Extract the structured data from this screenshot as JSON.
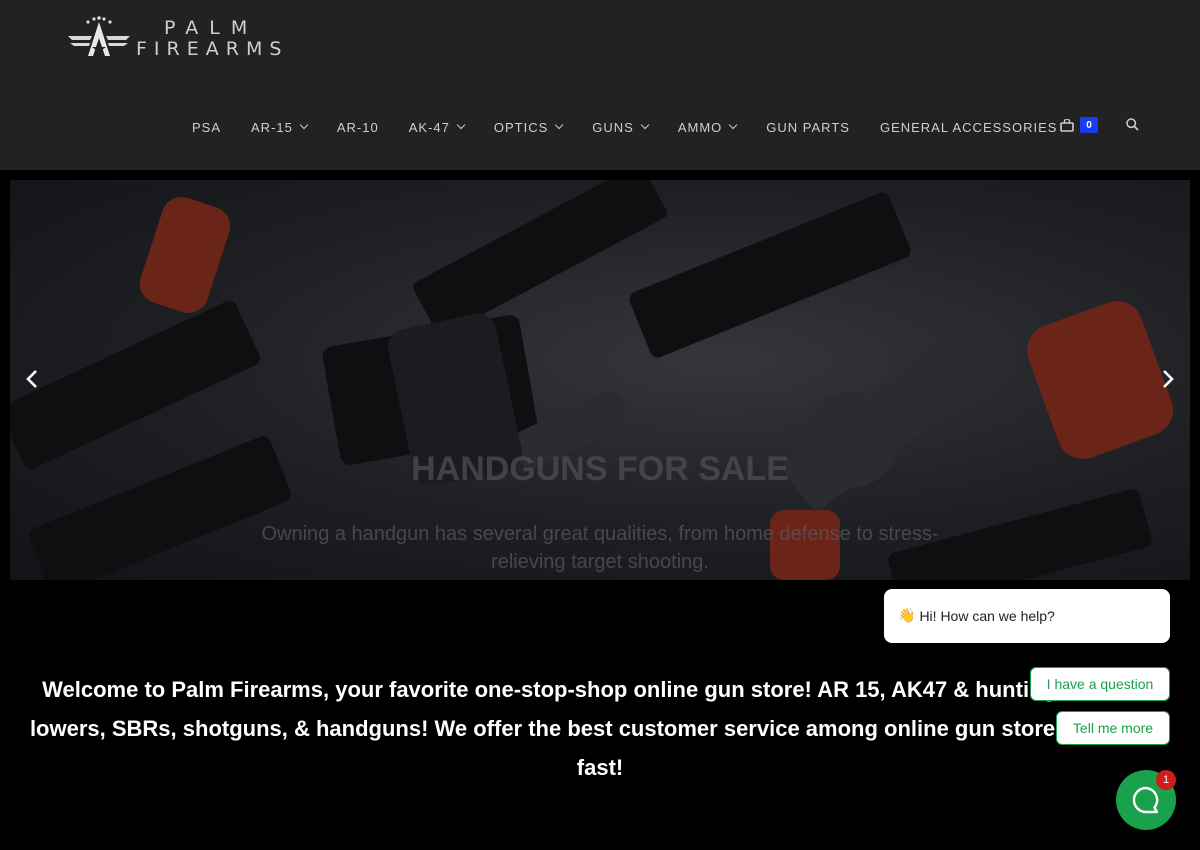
{
  "brand": {
    "line1": "PALM",
    "line2": "FIREARMS"
  },
  "nav": {
    "items": [
      {
        "label": "PSA",
        "dropdown": false
      },
      {
        "label": "AR-15",
        "dropdown": true
      },
      {
        "label": "AR-10",
        "dropdown": false
      },
      {
        "label": "AK-47",
        "dropdown": true
      },
      {
        "label": "OPTICS",
        "dropdown": true
      },
      {
        "label": "GUNS",
        "dropdown": true
      },
      {
        "label": "AMMO",
        "dropdown": true
      },
      {
        "label": "GUN PARTS",
        "dropdown": false
      },
      {
        "label": "GENERAL ACCESSORIES",
        "dropdown": false
      }
    ],
    "cart_count": "0"
  },
  "slider": {
    "title": "HANDGUNS FOR SALE",
    "subtitle": "Owning a handgun has several great qualities, from home defense to stress-relieving target shooting."
  },
  "welcome": {
    "text": "Welcome to Palm Firearms, your favorite one-stop-shop online gun store! AR 15, AK47 & hunting rifles, AR lowers, SBRs, shotguns, & handguns! We offer the best customer service among online gun stores, and ship fast!"
  },
  "chat": {
    "greeting_emoji": "👋",
    "greeting": "Hi! How can we help?",
    "option1": "I have a question",
    "option2": "Tell me more",
    "unread": "1"
  },
  "colors": {
    "header_bg": "#222222",
    "accent_blue": "#1a3cf0",
    "chat_green": "#1aa14b",
    "badge_red": "#d11a1a"
  }
}
